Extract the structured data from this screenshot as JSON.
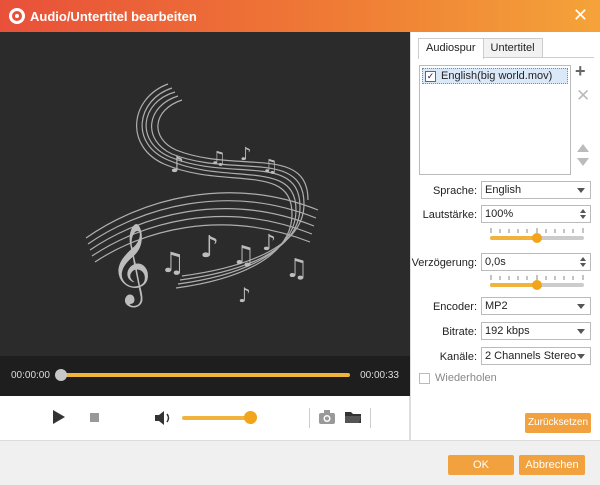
{
  "window": {
    "title": "Audio/Untertitel bearbeiten"
  },
  "player": {
    "time_current": "00:00:00",
    "time_total": "00:00:33",
    "progress": 0,
    "volume_percent": 85
  },
  "tabs": [
    {
      "label": "Audiospur",
      "active": true
    },
    {
      "label": "Untertitel",
      "active": false
    }
  ],
  "audio_tracks": [
    {
      "label": "English(big world.mov)",
      "checked": true
    }
  ],
  "settings": {
    "language_label": "Sprache:",
    "language_value": "English",
    "volume_label": "Lautstärke:",
    "volume_value": "100%",
    "volume_slider": 0.5,
    "delay_label": "Verzögerung:",
    "delay_value": "0,0s",
    "delay_slider": 0.5,
    "encoder_label": "Encoder:",
    "encoder_value": "MP2",
    "bitrate_label": "Bitrate:",
    "bitrate_value": "192 kbps",
    "channels_label": "Kanäle:",
    "channels_value": "2 Channels Stereo"
  },
  "repeat_label": "Wiederholen",
  "buttons": {
    "reset": "Zurücksetzen",
    "ok": "OK",
    "cancel": "Abbrechen"
  },
  "colors": {
    "accent": "#f2a13f",
    "title_start": "#e8503a",
    "title_end": "#f4a339"
  }
}
